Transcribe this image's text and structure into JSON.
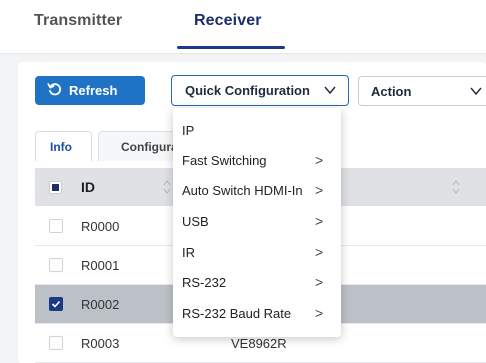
{
  "tabs": [
    {
      "label": "Transmitter",
      "active": false
    },
    {
      "label": "Receiver",
      "active": true
    }
  ],
  "toolbar": {
    "refresh_label": "Refresh",
    "quick_config_label": "Quick Configuration",
    "action_label": "Action"
  },
  "subtabs": [
    {
      "label": "Info",
      "active": true
    },
    {
      "label": "Configura",
      "active": false
    }
  ],
  "table": {
    "header": {
      "id": "ID"
    },
    "rows": [
      {
        "id": "R0000",
        "name": "",
        "selected": false
      },
      {
        "id": "R0001",
        "name": "",
        "selected": false
      },
      {
        "id": "R0002",
        "name": "",
        "selected": true
      },
      {
        "id": "R0003",
        "name": "VE8962R",
        "selected": false
      }
    ]
  },
  "dropdown": {
    "items": [
      {
        "label": "IP",
        "submenu": false
      },
      {
        "label": "Fast Switching",
        "submenu": true
      },
      {
        "label": "Auto Switch HDMI-In",
        "submenu": true
      },
      {
        "label": "USB",
        "submenu": true
      },
      {
        "label": "IR",
        "submenu": true
      },
      {
        "label": "RS-232",
        "submenu": true
      },
      {
        "label": "RS-232 Baud Rate",
        "submenu": true
      }
    ],
    "arrow": ">"
  },
  "colors": {
    "accent": "#1e73c5",
    "active_tab_text": "#1b2f6b",
    "selected_row": "#bcc1c8",
    "checkbox_checked": "#1b3a86"
  },
  "icons": {
    "refresh": "refresh-icon",
    "chevron": "chevron-down-icon",
    "sort": "sort-icon",
    "check": "check-icon"
  }
}
